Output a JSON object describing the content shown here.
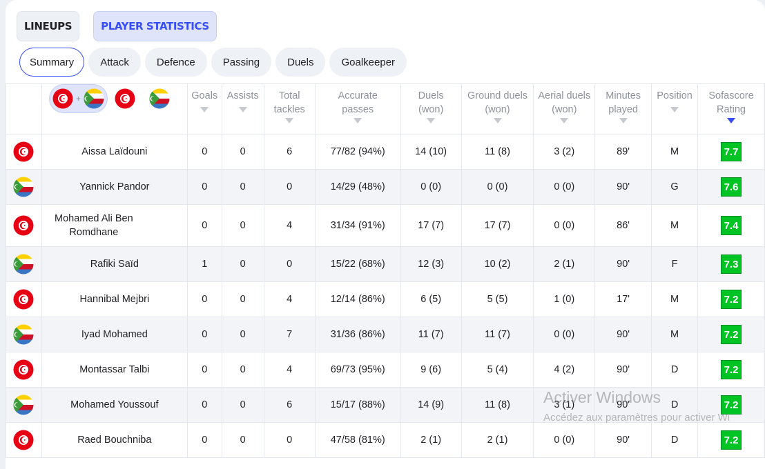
{
  "top_tabs": [
    {
      "label": "LINEUPS",
      "active": false
    },
    {
      "label": "PLAYER STATISTICS",
      "active": true
    }
  ],
  "sub_tabs": [
    {
      "label": "Summary",
      "active": true
    },
    {
      "label": "Attack",
      "active": false
    },
    {
      "label": "Defence",
      "active": false
    },
    {
      "label": "Passing",
      "active": false
    },
    {
      "label": "Duels",
      "active": false
    },
    {
      "label": "Goalkeeper",
      "active": false
    }
  ],
  "team_filter": {
    "selected": "both-teams-icon",
    "options": [
      "tunisia-flag-icon",
      "comoros-flag-icon"
    ]
  },
  "columns": [
    {
      "label": "Goals",
      "sorted": false
    },
    {
      "label": "Assists",
      "sorted": false
    },
    {
      "label": "Total tackles",
      "sorted": false
    },
    {
      "label": "Accurate passes",
      "sorted": false
    },
    {
      "label": "Duels (won)",
      "sorted": false
    },
    {
      "label": "Ground duels (won)",
      "sorted": false
    },
    {
      "label": "Aerial duels (won)",
      "sorted": false
    },
    {
      "label": "Minutes played",
      "sorted": false
    },
    {
      "label": "Position",
      "sorted": false
    },
    {
      "label": "Sofascore Rating",
      "sorted": true
    }
  ],
  "players": [
    {
      "team": "tunisia",
      "name": "Aissa Laïdouni",
      "goals": "0",
      "assists": "0",
      "tackles": "6",
      "passes": "77/82 (94%)",
      "duels": "14 (10)",
      "ground": "11 (8)",
      "aerial": "3 (2)",
      "minutes": "89'",
      "position": "M",
      "rating": "7.7"
    },
    {
      "team": "comoros",
      "name": "Yannick Pandor",
      "goals": "0",
      "assists": "0",
      "tackles": "0",
      "passes": "14/29 (48%)",
      "duels": "0 (0)",
      "ground": "0 (0)",
      "aerial": "0 (0)",
      "minutes": "90'",
      "position": "G",
      "rating": "7.6"
    },
    {
      "team": "tunisia",
      "name": "Mohamed Ali Ben Romdhane",
      "goals": "0",
      "assists": "0",
      "tackles": "4",
      "passes": "31/34 (91%)",
      "duels": "17 (7)",
      "ground": "17 (7)",
      "aerial": "0 (0)",
      "minutes": "86'",
      "position": "M",
      "rating": "7.4"
    },
    {
      "team": "comoros",
      "name": "Rafiki Saïd",
      "goals": "1",
      "assists": "0",
      "tackles": "0",
      "passes": "15/22 (68%)",
      "duels": "12 (3)",
      "ground": "10 (2)",
      "aerial": "2 (1)",
      "minutes": "90'",
      "position": "F",
      "rating": "7.3"
    },
    {
      "team": "tunisia",
      "name": "Hannibal Mejbri",
      "goals": "0",
      "assists": "0",
      "tackles": "4",
      "passes": "12/14 (86%)",
      "duels": "6 (5)",
      "ground": "5 (5)",
      "aerial": "1 (0)",
      "minutes": "17'",
      "position": "M",
      "rating": "7.2"
    },
    {
      "team": "comoros",
      "name": "Iyad Mohamed",
      "goals": "0",
      "assists": "0",
      "tackles": "7",
      "passes": "31/36 (86%)",
      "duels": "11 (7)",
      "ground": "11 (7)",
      "aerial": "0 (0)",
      "minutes": "90'",
      "position": "M",
      "rating": "7.2"
    },
    {
      "team": "tunisia",
      "name": "Montassar Talbi",
      "goals": "0",
      "assists": "0",
      "tackles": "4",
      "passes": "69/73 (95%)",
      "duels": "9 (6)",
      "ground": "5 (4)",
      "aerial": "4 (2)",
      "minutes": "90'",
      "position": "D",
      "rating": "7.2"
    },
    {
      "team": "comoros",
      "name": "Mohamed Youssouf",
      "goals": "0",
      "assists": "0",
      "tackles": "6",
      "passes": "15/17 (88%)",
      "duels": "14 (9)",
      "ground": "11 (8)",
      "aerial": "3 (1)",
      "minutes": "90'",
      "position": "D",
      "rating": "7.2"
    },
    {
      "team": "tunisia",
      "name": "Raed Bouchniba",
      "goals": "0",
      "assists": "0",
      "tackles": "0",
      "passes": "47/58 (81%)",
      "duels": "2 (1)",
      "ground": "2 (1)",
      "aerial": "0 (0)",
      "minutes": "90'",
      "position": "D",
      "rating": "7.2"
    }
  ],
  "colors": {
    "accent": "#374df5",
    "rating_bg": "#00c424",
    "tunisia_red": "#e70013",
    "comoros_green": "#3a9b3a",
    "comoros_yellow": "#ffd000",
    "comoros_red": "#ce1126",
    "comoros_blue": "#3a75c4"
  },
  "watermark": {
    "line1": "Activer Windows",
    "line2": "Accédez aux paramètres pour activer Wi"
  }
}
